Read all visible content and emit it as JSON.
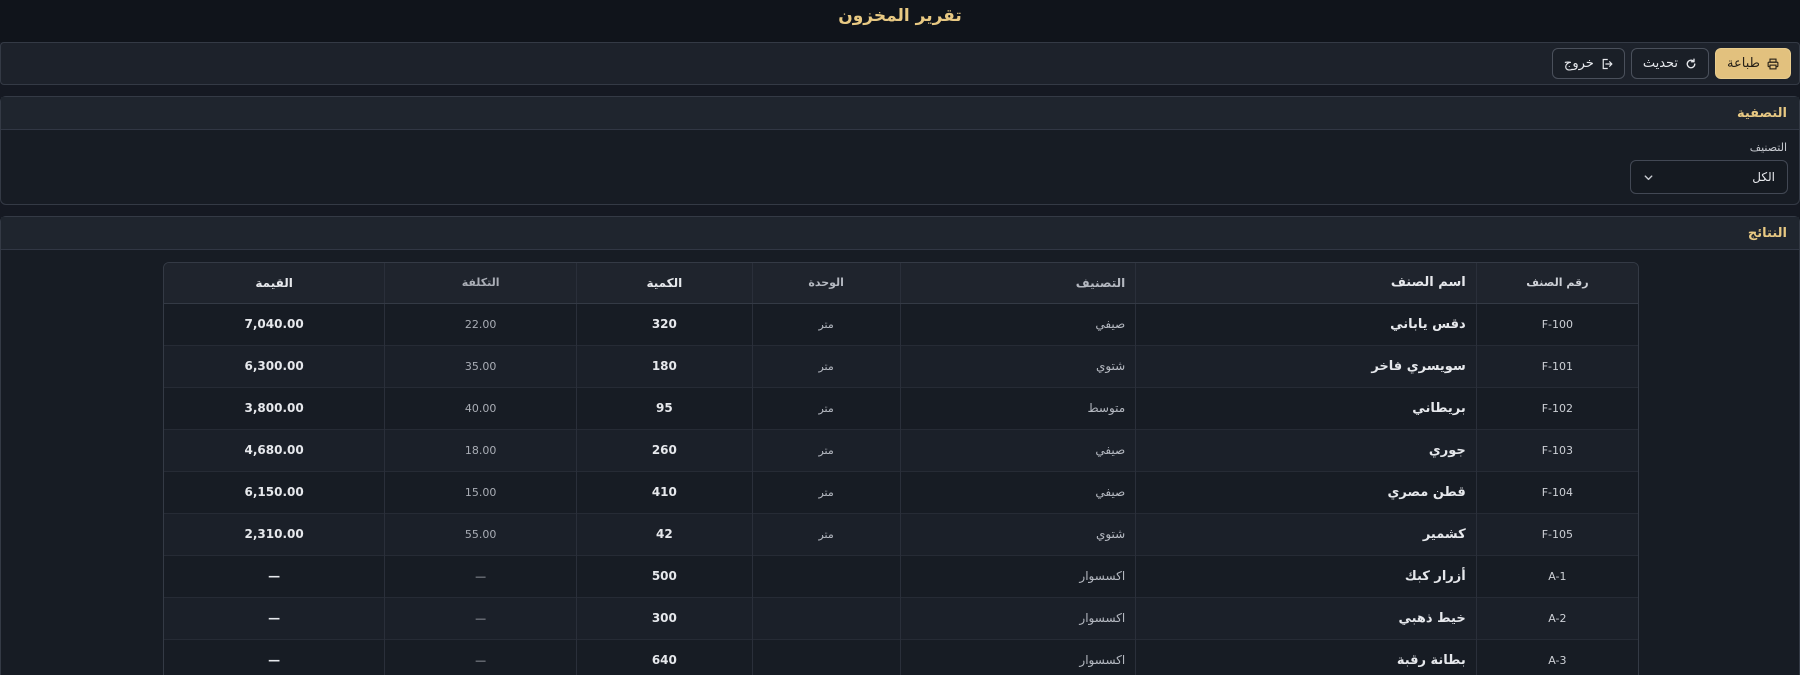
{
  "page": {
    "title": "تقرير المخزون"
  },
  "toolbar": {
    "print_label": "طباعة",
    "refresh_label": "تحديث",
    "exit_label": "خروج"
  },
  "filter": {
    "title": "التصفية",
    "category_label": "التصنيف",
    "category_value": "الكل"
  },
  "results": {
    "title": "النتائج",
    "columns": [
      "رقم الصنف",
      "اسم الصنف",
      "التصنيف",
      "الوحدة",
      "الكمية",
      "التكلفة",
      "القيمة"
    ],
    "rows": [
      [
        "F-100",
        "دقس ياباني",
        "صيفي",
        "متر",
        "320",
        "22.00",
        "7,040.00"
      ],
      [
        "F-101",
        "سويسري فاخر",
        "شتوي",
        "متر",
        "180",
        "35.00",
        "6,300.00"
      ],
      [
        "F-102",
        "بريطاني",
        "متوسط",
        "متر",
        "95",
        "40.00",
        "3,800.00"
      ],
      [
        "F-103",
        "جوري",
        "صيفي",
        "متر",
        "260",
        "18.00",
        "4,680.00"
      ],
      [
        "F-104",
        "قطن مصري",
        "صيفي",
        "متر",
        "410",
        "15.00",
        "6,150.00"
      ],
      [
        "F-105",
        "كشمير",
        "شتوي",
        "متر",
        "42",
        "55.00",
        "2,310.00"
      ],
      [
        "A-1",
        "أزرار كبك",
        "اكسسوار",
        "",
        "500",
        "—",
        "—"
      ],
      [
        "A-2",
        "خيط ذهبي",
        "اكسسوار",
        "",
        "300",
        "—",
        "—"
      ],
      [
        "A-3",
        "بطانة رقبة",
        "اكسسوار",
        "",
        "640",
        "—",
        "—"
      ]
    ]
  },
  "colors": {
    "accent": "#e8c983",
    "primary_button": "#e2c17e",
    "background": "#151922",
    "panel": "#171c24"
  },
  "icons": {
    "print": "printer-icon",
    "refresh": "refresh-icon",
    "exit": "logout-icon",
    "select": "chevron-down-icon"
  }
}
